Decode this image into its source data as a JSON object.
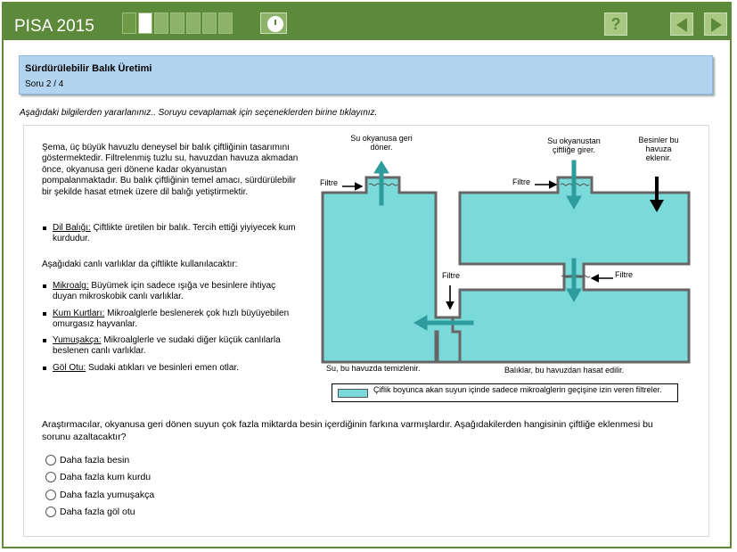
{
  "app": {
    "title": "PISA 2015"
  },
  "progress": {
    "segments": 7,
    "completed": 1,
    "current": 2
  },
  "nav": {
    "help_label": "?"
  },
  "unit": {
    "title": "Sürdürülebilir Balık Üretimi",
    "subtitle": "Soru 2 / 4"
  },
  "instruction": "Aşağıdaki bilgilerden yararlanınız.. Soruyu cevaplamak için seçeneklerden birine tıklayınız.",
  "intro": {
    "paragraph": "Şema, üç büyük havuzlu deneysel bir balık çiftliğinin tasarımını göstermektedir. Filtrelenmiş tuzlu su, havuzdan havuza akmadan önce, okyanusa geri dönene kadar okyanustan pompalanmaktadır. Bu balık çiftliğinin temel amacı, sürdürülebilir bir şekilde hasat etmek üzere dil balığı yetiştirmektir.",
    "item1_term": "Dil Balığı:",
    "item1_text": " Çiftlikte üretilen bir balık. Tercih ettiği yiyiyecek kum kurdudur.",
    "paragraph2": "Aşağıdaki canlı varlıklar da çiftlikte kullanılacaktır:",
    "items": [
      {
        "term": "Mikroalg:",
        "text": " Büyümek için sadece ışığa ve besinlere ihtiyaç duyan mikroskobik canlı varlıklar."
      },
      {
        "term": "Kum Kurtları:",
        "text": " Mikroalglerle beslenerek çok hızlı büyüyebilen omurgasız hayvanlar."
      },
      {
        "term": "Yumuşakça:",
        "text": " Mikroalglerle ve sudaki diğer küçük canlılarla beslenen canlı varlıklar."
      },
      {
        "term": "Göl Otu:",
        "text": " Sudaki atıkları ve besinleri emen otlar."
      }
    ]
  },
  "diagram": {
    "label_return_1": "Su okyanusa geri",
    "label_return_2": "döner.",
    "label_enter_1": "Su okyanustan",
    "label_enter_2": "çiftliğe girer.",
    "label_nutrients_1": "Besinler bu",
    "label_nutrients_2": "havuza",
    "label_nutrients_3": "eklenir.",
    "filter_label": "Filtre",
    "caption_left": "Su, bu havuzda temizlenir.",
    "caption_right": "Balıklar, bu havuzdan hasat edilir.",
    "legend_text": "Çiflik boyunca akan suyun içinde sadece mikroalglerin geçişine izin veren filtreler.",
    "water_color": "#7ad9d9",
    "arrow_color": "#2e9c9c"
  },
  "question": "Araştırmacılar, okyanusa geri dönen suyun çok fazla miktarda besin içerdiğinin farkına varmışlardır. Aşağıdakilerden hangisinin çiftliğe eklenmesi bu sorunu azaltacaktır?",
  "options": [
    "Daha fazla besin",
    "Daha fazla kum kurdu",
    "Daha fazla yumuşakça",
    "Daha fazla göl otu"
  ],
  "colors": {
    "brand_green": "#5d8a3a",
    "header_blue": "#b3d4f0"
  }
}
